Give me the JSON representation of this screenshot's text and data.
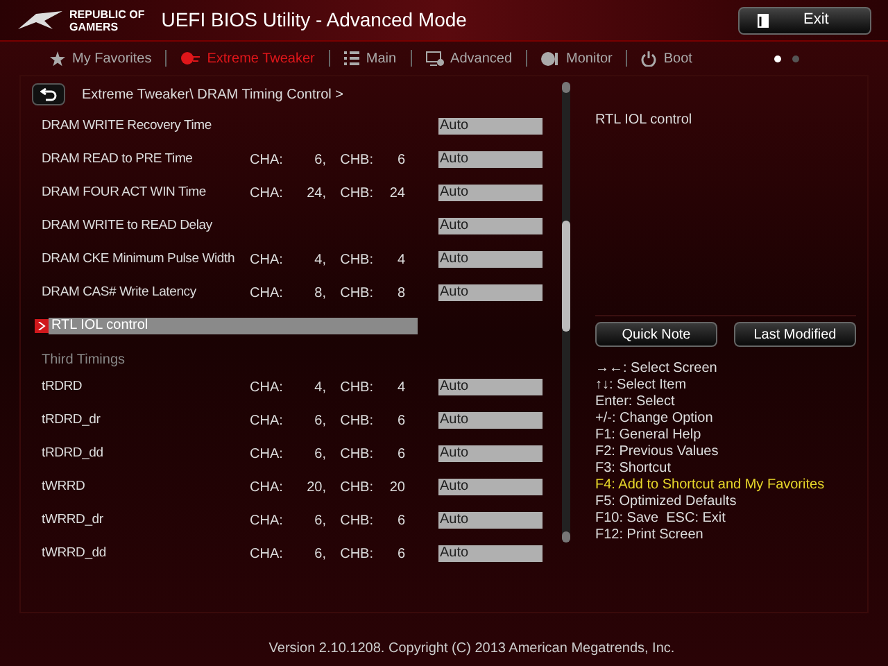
{
  "header": {
    "brand": [
      "REPUBLIC OF",
      "GAMERS"
    ],
    "title": "UEFI BIOS Utility - Advanced Mode",
    "exit_button": "Exit"
  },
  "tabs": [
    {
      "label": "My Favorites",
      "selected": false
    },
    {
      "label": "Extreme Tweaker",
      "selected": true
    },
    {
      "label": "Main",
      "selected": false
    },
    {
      "label": "Advanced",
      "selected": false
    },
    {
      "label": "Monitor",
      "selected": false
    },
    {
      "label": "Boot",
      "selected": false
    }
  ],
  "page_dots": [
    {
      "selected": true
    },
    {
      "selected": false
    }
  ],
  "breadcrumb": "Extreme Tweaker\\ DRAM Timing Control >",
  "rows": [
    {
      "kind": "setting",
      "label": "DRAM WRITE Recovery Time",
      "value": "Auto",
      "selected": false
    },
    {
      "kind": "setting",
      "label": "DRAM READ to PRE Time",
      "cha_label": "CHA:",
      "cha": "6,",
      "chb_label": "CHB:",
      "chb": "6",
      "value": "Auto",
      "selected": false
    },
    {
      "kind": "setting",
      "label": "DRAM FOUR ACT WIN Time",
      "cha_label": "CHA:",
      "cha": "24,",
      "chb_label": "CHB:",
      "chb": "24",
      "value": "Auto",
      "selected": false
    },
    {
      "kind": "setting",
      "label": "DRAM WRITE to READ Delay",
      "value": "Auto",
      "selected": false
    },
    {
      "kind": "setting",
      "label": "DRAM CKE Minimum Pulse Width",
      "cha_label": "CHA:",
      "cha": "4,",
      "chb_label": "CHB:",
      "chb": "4",
      "value": "Auto",
      "selected": false
    },
    {
      "kind": "setting",
      "label": "DRAM CAS# Write Latency",
      "cha_label": "CHA:",
      "cha": "8,",
      "chb_label": "CHB:",
      "chb": "8",
      "value": "Auto",
      "selected": false
    },
    {
      "kind": "submenu",
      "label": "RTL IOL control",
      "selected": true
    },
    {
      "kind": "header",
      "label": "Third Timings"
    },
    {
      "kind": "setting",
      "label": "tRDRD",
      "cha_label": "CHA:",
      "cha": "4,",
      "chb_label": "CHB:",
      "chb": "4",
      "value": "Auto",
      "selected": false
    },
    {
      "kind": "setting",
      "label": "tRDRD_dr",
      "cha_label": "CHA:",
      "cha": "6,",
      "chb_label": "CHB:",
      "chb": "6",
      "value": "Auto",
      "selected": false
    },
    {
      "kind": "setting",
      "label": "tRDRD_dd",
      "cha_label": "CHA:",
      "cha": "6,",
      "chb_label": "CHB:",
      "chb": "6",
      "value": "Auto",
      "selected": false
    },
    {
      "kind": "setting",
      "label": "tWRRD",
      "cha_label": "CHA:",
      "cha": "20,",
      "chb_label": "CHB:",
      "chb": "20",
      "value": "Auto",
      "selected": false
    },
    {
      "kind": "setting",
      "label": "tWRRD_dr",
      "cha_label": "CHA:",
      "cha": "6,",
      "chb_label": "CHB:",
      "chb": "6",
      "value": "Auto",
      "selected": false
    },
    {
      "kind": "setting",
      "label": "tWRRD_dd",
      "cha_label": "CHA:",
      "cha": "6,",
      "chb_label": "CHB:",
      "chb": "6",
      "value": "Auto",
      "selected": false
    }
  ],
  "help": {
    "description": "RTL IOL control",
    "buttons": [
      "Quick Note",
      "Last Modified"
    ],
    "keys": [
      {
        "text": "→←: Select Screen",
        "highlighted": false
      },
      {
        "text": "↑↓: Select Item",
        "highlighted": false
      },
      {
        "text": "Enter: Select",
        "highlighted": false
      },
      {
        "text": "+/-: Change Option",
        "highlighted": false
      },
      {
        "text": "F1: General Help",
        "highlighted": false
      },
      {
        "text": "F2: Previous Values",
        "highlighted": false
      },
      {
        "text": "F3: Shortcut",
        "highlighted": false
      },
      {
        "text": "F4: Add to Shortcut and My Favorites",
        "highlighted": true
      },
      {
        "text": "F5: Optimized Defaults",
        "highlighted": false
      },
      {
        "text": "F10: Save  ESC: Exit",
        "highlighted": false
      },
      {
        "text": "F12: Print Screen",
        "highlighted": false
      }
    ]
  },
  "footer": "Version 2.10.1208. Copyright (C) 2013 American Megatrends, Inc."
}
